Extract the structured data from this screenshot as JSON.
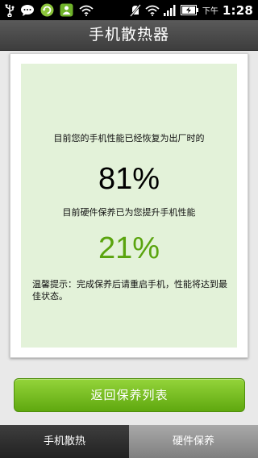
{
  "status_bar": {
    "icons_left": [
      "usb-icon",
      "chat-bubble-icon",
      "refresh-app-icon",
      "app-notification-icon",
      "wifi-icon"
    ],
    "icons_right": [
      "silent-icon",
      "wifi-icon",
      "signal-icon",
      "battery-charging-icon"
    ],
    "period": "下午",
    "time": "1:28"
  },
  "header": {
    "title": "手机散热器"
  },
  "card": {
    "message_top": "目前您的手机性能已经恢复为出厂时的",
    "performance_percent": "81%",
    "message_middle": "目前硬件保养已为您提升手机性能",
    "improvement_percent": "21%",
    "tip": "温馨提示：完成保养后请重启手机，性能将达到最佳状态。"
  },
  "actions": {
    "back_button_label": "返回保养列表"
  },
  "tabs": [
    {
      "label": "手机散热",
      "active": true
    },
    {
      "label": "硬件保养",
      "active": false
    }
  ],
  "colors": {
    "accent_green": "#5aa40e",
    "panel_bg": "#e3f2d9"
  }
}
